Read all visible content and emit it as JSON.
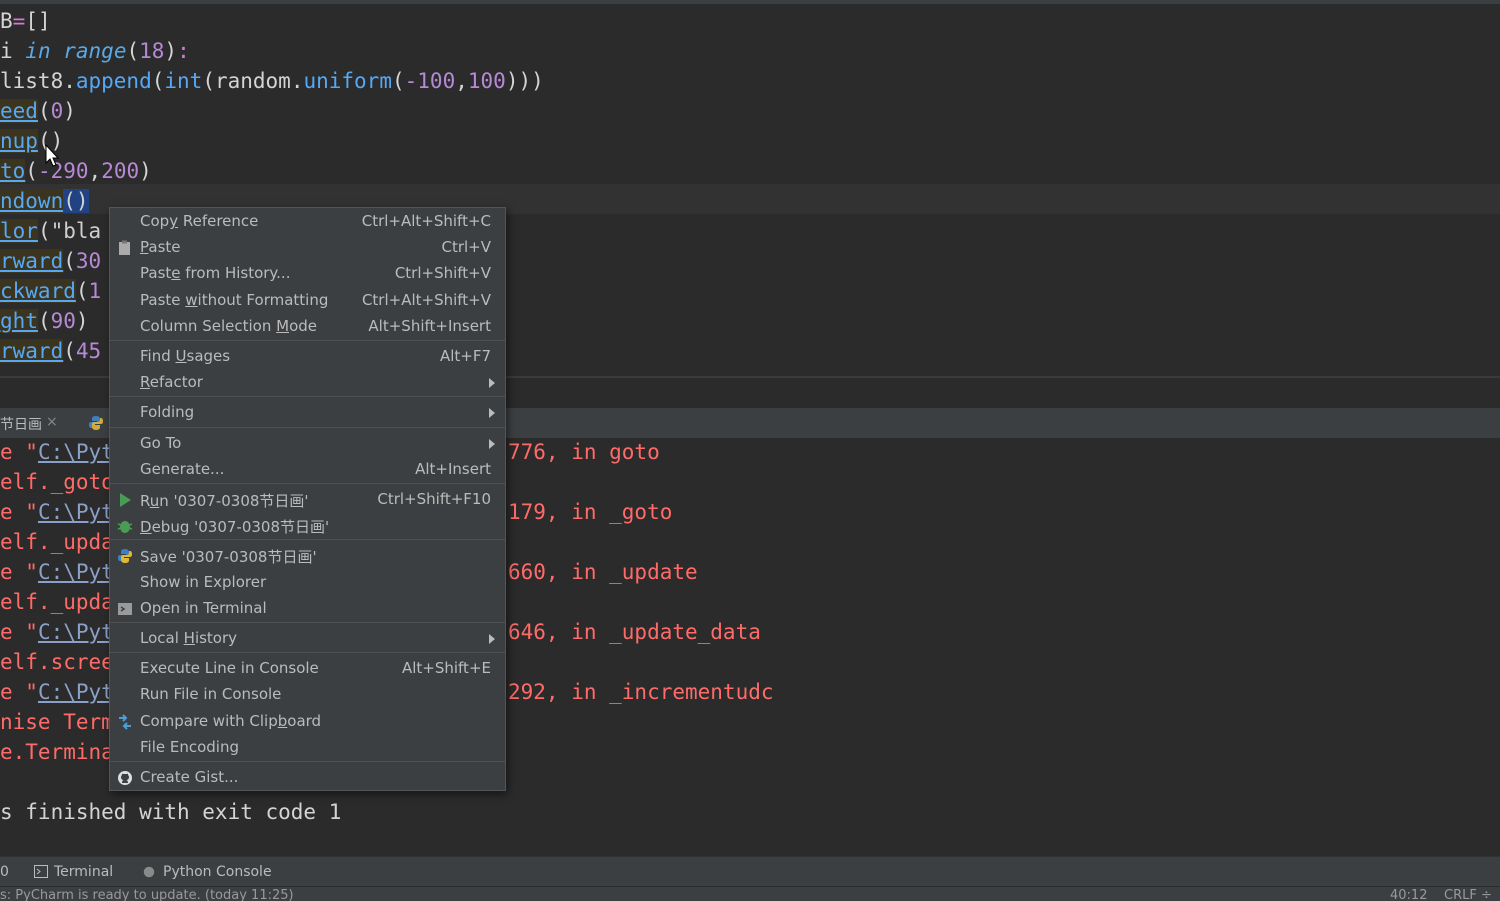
{
  "editor": {
    "lines": [
      {
        "parts": [
          [
            "B",
            ""
          ],
          [
            "=",
            "op"
          ],
          [
            "[]",
            "paren"
          ]
        ]
      },
      {
        "parts": [
          [
            "i ",
            ""
          ],
          [
            "in",
            "kw"
          ],
          [
            " ",
            ""
          ],
          [
            "range",
            "kw"
          ],
          [
            "(",
            "paren"
          ],
          [
            "18",
            "num"
          ],
          [
            ")",
            "paren"
          ],
          [
            ":",
            "op"
          ]
        ]
      },
      {
        "parts": [
          [
            "list8.",
            ""
          ],
          [
            "append",
            "fn-plain"
          ],
          [
            "(",
            "paren"
          ],
          [
            "int",
            "fn-plain"
          ],
          [
            "(random.",
            ""
          ],
          [
            "uniform",
            "fn-plain"
          ],
          [
            "(",
            "paren"
          ],
          [
            "-100",
            "num"
          ],
          [
            ",",
            ""
          ],
          [
            "100",
            "num"
          ],
          [
            ")))",
            "paren"
          ]
        ]
      },
      {
        "parts": [
          [
            "eed",
            "fn"
          ],
          [
            "(",
            "paren"
          ],
          [
            "0",
            "num"
          ],
          [
            ")",
            "paren"
          ]
        ]
      },
      {
        "parts": [
          [
            "nup",
            "fn"
          ],
          [
            "()",
            "paren"
          ]
        ]
      },
      {
        "parts": [
          [
            "to",
            "fn"
          ],
          [
            "(",
            "paren"
          ],
          [
            "-290",
            "num"
          ],
          [
            ",",
            ""
          ],
          [
            "200",
            "num"
          ],
          [
            ")",
            "paren"
          ]
        ]
      },
      {
        "parts": [
          [
            "ndown",
            "fn"
          ],
          [
            "()",
            "sel"
          ]
        ]
      },
      {
        "parts": [
          [
            "lor",
            "fn"
          ],
          [
            "(",
            "paren"
          ],
          [
            "\"bla",
            "str"
          ]
        ]
      },
      {
        "parts": [
          [
            "rward",
            "fn"
          ],
          [
            "(",
            "paren"
          ],
          [
            "30",
            "num"
          ]
        ]
      },
      {
        "parts": [
          [
            "ckward",
            "fn"
          ],
          [
            "(",
            "paren"
          ],
          [
            "1",
            "num"
          ]
        ]
      },
      {
        "parts": [
          [
            "ght",
            "fn"
          ],
          [
            "(",
            "paren"
          ],
          [
            "90",
            "num"
          ],
          [
            ")",
            "paren"
          ]
        ]
      },
      {
        "parts": [
          [
            "rward",
            "fn"
          ],
          [
            "(",
            "paren"
          ],
          [
            "45",
            "num"
          ]
        ]
      }
    ]
  },
  "run_tab": {
    "label": "节日画",
    "close": "×"
  },
  "console": {
    "left_lines": [
      "e \"",
      "elf._goto",
      "e \"",
      "elf._upda",
      "e \"",
      "elf._upda",
      "e \"",
      "elf.scree",
      "e \"",
      "nise Term",
      "e.Termina"
    ],
    "path_text": "C:\\Pyt",
    "right_lines": [
      "776, in goto",
      "179, in _goto",
      "660, in _update",
      "646, in _update_data",
      "292, in _incrementudc"
    ],
    "finished": "s finished with exit code 1"
  },
  "toolbar": {
    "item0": "0",
    "terminal": "Terminal",
    "python_console": "Python Console"
  },
  "status": {
    "message": "s: PyCharm is ready to update. (today 11:25)",
    "position": "40:12",
    "line_sep": "CRLF ÷"
  },
  "context_menu": {
    "items": [
      {
        "label": "Copy Reference",
        "shortcut": "Ctrl+Alt+Shift+C"
      },
      {
        "label": "Paste",
        "shortcut": "Ctrl+V",
        "icon": "clipboard-icon"
      },
      {
        "label": "Paste from History...",
        "shortcut": "Ctrl+Shift+V"
      },
      {
        "label": "Paste without Formatting",
        "shortcut": "Ctrl+Alt+Shift+V"
      },
      {
        "label": "Column Selection Mode",
        "shortcut": "Alt+Shift+Insert"
      },
      {
        "label": "Find Usages",
        "shortcut": "Alt+F7"
      },
      {
        "label": "Refactor",
        "submenu": true
      },
      {
        "label": "Folding",
        "submenu": true
      },
      {
        "label": "Go To",
        "submenu": true
      },
      {
        "label": "Generate...",
        "shortcut": "Alt+Insert"
      },
      {
        "label": "Run '0307-0308节日画'",
        "shortcut": "Ctrl+Shift+F10",
        "icon": "run-icon"
      },
      {
        "label": "Debug '0307-0308节日画'",
        "icon": "debug-icon"
      },
      {
        "label": "Save '0307-0308节日画'",
        "icon": "python-icon"
      },
      {
        "label": "Show in Explorer"
      },
      {
        "label": "Open in Terminal",
        "icon": "terminal-icon"
      },
      {
        "label": "Local History",
        "submenu": true
      },
      {
        "label": "Execute Line in Console",
        "shortcut": "Alt+Shift+E"
      },
      {
        "label": "Run File in Console"
      },
      {
        "label": "Compare with Clipboard",
        "icon": "compare-icon"
      },
      {
        "label": "File Encoding"
      },
      {
        "label": "Create Gist...",
        "icon": "github-icon"
      }
    ]
  }
}
